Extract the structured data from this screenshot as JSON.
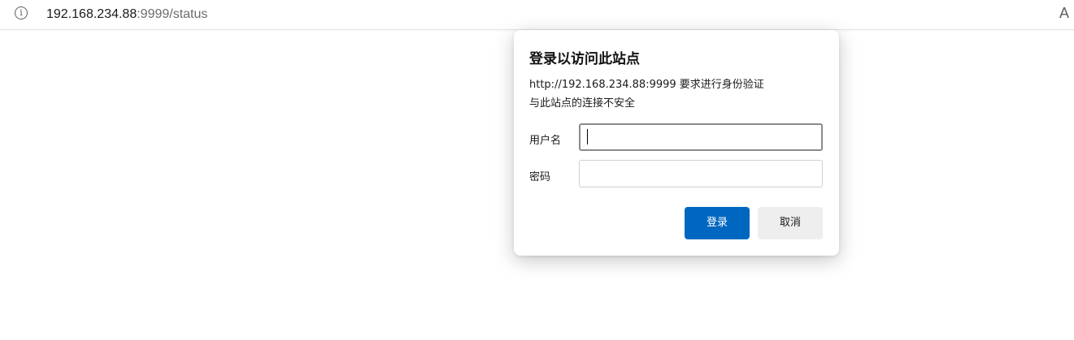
{
  "address_bar": {
    "info_icon": "info-icon",
    "url_host": "192.168.234.88",
    "url_rest": ":9999/status",
    "read_aloud_icon": "read-aloud-icon",
    "read_aloud_glyph": "A"
  },
  "auth_dialog": {
    "title": "登录以访问此站点",
    "message_line1": "http://192.168.234.88:9999 要求进行身份验证",
    "message_line2": "与此站点的连接不安全",
    "username_label": "用户名",
    "username_value": "",
    "password_label": "密码",
    "password_value": "",
    "login_button": "登录",
    "cancel_button": "取消",
    "colors": {
      "primary_button": "#0067c0",
      "secondary_button": "#eeeeee"
    }
  }
}
